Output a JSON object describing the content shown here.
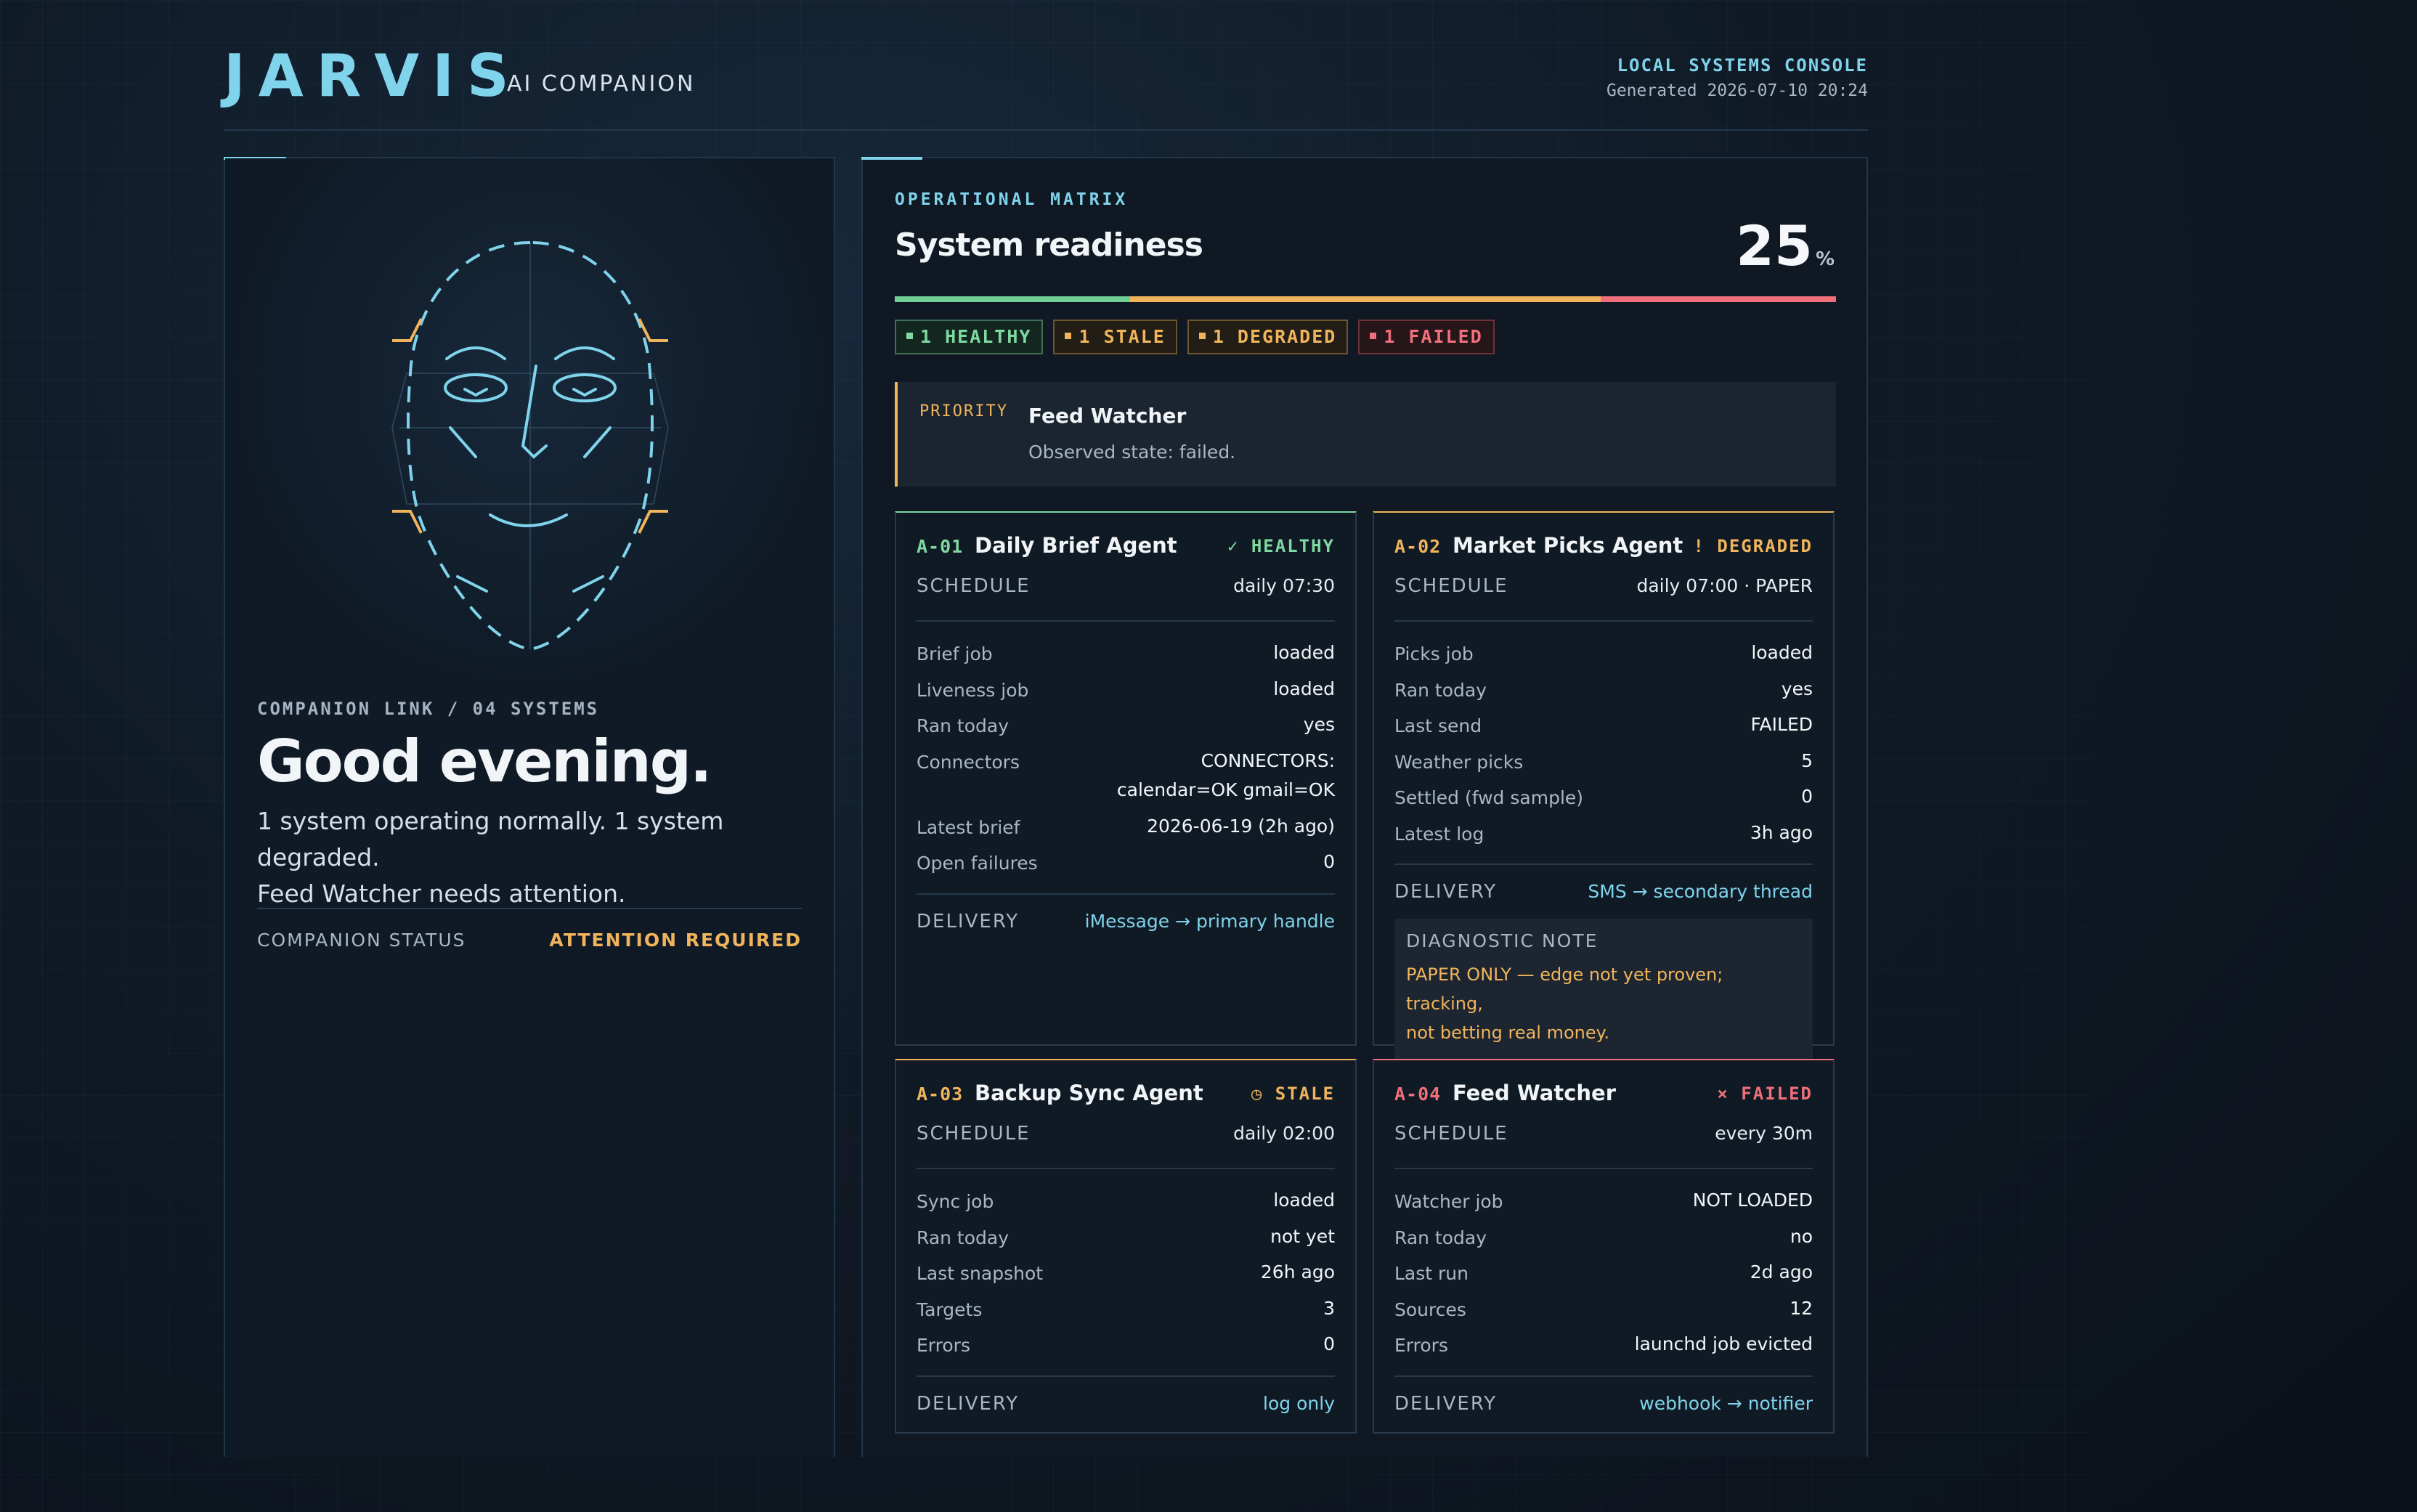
{
  "header": {
    "brand": "JARVIS",
    "brand_sub": "AI COMPANION",
    "console_title": "LOCAL SYSTEMS CONSOLE",
    "generated": "Generated 2026-07-10 20:24"
  },
  "companion": {
    "link_label": "COMPANION LINK / 04 SYSTEMS",
    "greeting": "Good evening.",
    "summary_line1": "1 system operating normally. 1 system degraded.",
    "summary_line2": "Feed Watcher needs attention.",
    "status_label": "COMPANION STATUS",
    "status_value": "ATTENTION REQUIRED"
  },
  "matrix": {
    "label": "OPERATIONAL MATRIX",
    "title": "System readiness",
    "readiness_value": "25",
    "readiness_unit": "%",
    "readiness_fraction": 0.25,
    "bar_colors": [
      "#6fcf97",
      "#f0b45c",
      "#f0b45c",
      "#ef6f7a"
    ],
    "badges": {
      "healthy": "1 HEALTHY",
      "stale": "1 STALE",
      "degraded": "1 DEGRADED",
      "failed": "1 FAILED"
    },
    "priority": {
      "label": "PRIORITY",
      "title": "Feed Watcher",
      "description": "Observed state: failed."
    }
  },
  "agents": [
    {
      "id": "A-01",
      "name": "Daily Brief Agent",
      "state": "✓ HEALTHY",
      "schedule_label": "SCHEDULE",
      "schedule": "daily 07:30",
      "rows": [
        {
          "k": "Brief job",
          "v": "loaded"
        },
        {
          "k": "Liveness job",
          "v": "loaded"
        },
        {
          "k": "Ran today",
          "v": "yes"
        },
        {
          "k": "Connectors",
          "v": "CONNECTORS:",
          "v2": "calendar=OK gmail=OK"
        },
        {
          "k": "Latest brief",
          "v": "2026-06-19 (2h ago)"
        },
        {
          "k": "Open failures",
          "v": "0"
        }
      ],
      "delivery_label": "DELIVERY",
      "delivery": "iMessage → primary handle"
    },
    {
      "id": "A-02",
      "name": "Market Picks Agent",
      "state": "! DEGRADED",
      "schedule_label": "SCHEDULE",
      "schedule": "daily 07:00 · PAPER",
      "rows": [
        {
          "k": "Picks job",
          "v": "loaded"
        },
        {
          "k": "Ran today",
          "v": "yes"
        },
        {
          "k": "Last send",
          "v": "FAILED"
        },
        {
          "k": "Weather picks",
          "v": "5"
        },
        {
          "k": "Settled (fwd sample)",
          "v": "0"
        },
        {
          "k": "Latest log",
          "v": "3h ago"
        }
      ],
      "delivery_label": "DELIVERY",
      "delivery": "SMS → secondary thread",
      "diag_title": "DIAGNOSTIC NOTE",
      "diag_line1": "PAPER ONLY — edge not yet proven; tracking,",
      "diag_line2": "not betting real money."
    },
    {
      "id": "A-03",
      "name": "Backup Sync Agent",
      "state": "◷ STALE",
      "schedule_label": "SCHEDULE",
      "schedule": "daily 02:00",
      "rows": [
        {
          "k": "Sync job",
          "v": "loaded"
        },
        {
          "k": "Ran today",
          "v": "not yet"
        },
        {
          "k": "Last snapshot",
          "v": "26h ago"
        },
        {
          "k": "Targets",
          "v": "3"
        },
        {
          "k": "Errors",
          "v": "0"
        }
      ],
      "delivery_label": "DELIVERY",
      "delivery": "log only"
    },
    {
      "id": "A-04",
      "name": "Feed Watcher",
      "state": "× FAILED",
      "schedule_label": "SCHEDULE",
      "schedule": "every 30m",
      "rows": [
        {
          "k": "Watcher job",
          "v": "NOT LOADED"
        },
        {
          "k": "Ran today",
          "v": "no"
        },
        {
          "k": "Last run",
          "v": "2d ago"
        },
        {
          "k": "Sources",
          "v": "12"
        },
        {
          "k": "Errors",
          "v": "launchd job evicted"
        }
      ],
      "delivery_label": "DELIVERY",
      "delivery": "webhook → notifier"
    }
  ],
  "colors": {
    "accent": "#7fd3ea",
    "healthy": "#7fd8a0",
    "warning": "#f0b45c",
    "failed": "#ef6f7a"
  }
}
